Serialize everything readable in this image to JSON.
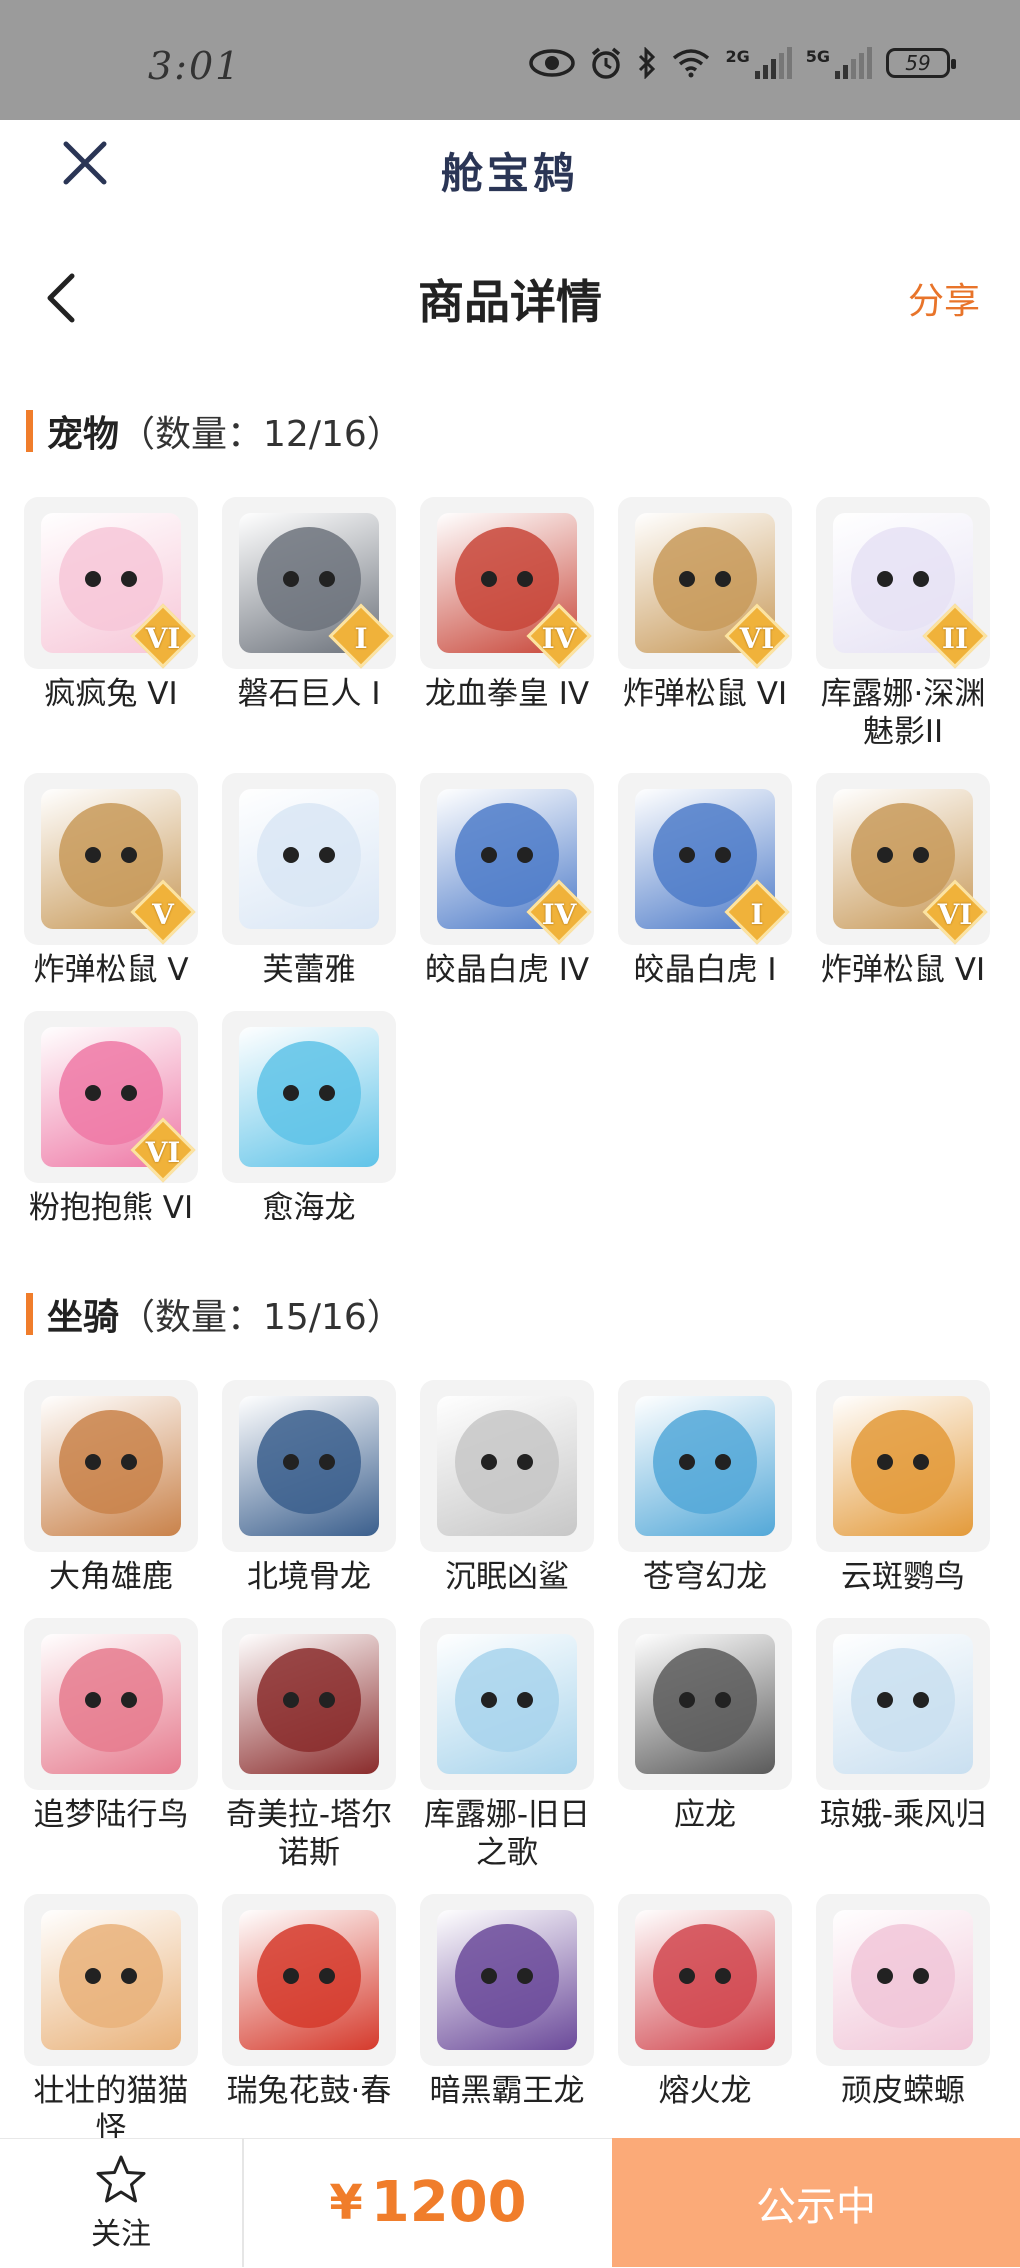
{
  "status_bar": {
    "time": "3:01",
    "battery": "59",
    "net1": "2G",
    "net2": "5G"
  },
  "header": {
    "app_title": "舱宝鸫"
  },
  "nav": {
    "title": "商品详情",
    "share": "分享"
  },
  "pets": {
    "section_name": "宠物",
    "count_text": "（数量：12/16）",
    "items": [
      {
        "label": "疯疯兔 VI",
        "tier": "VI",
        "color": "#f7c7d8"
      },
      {
        "label": "磐石巨人 I",
        "tier": "I",
        "color": "#6d737c"
      },
      {
        "label": "龙血拳皇 IV",
        "tier": "IV",
        "color": "#c8473a"
      },
      {
        "label": "炸弹松鼠 VI",
        "tier": "VI",
        "color": "#c89a5a"
      },
      {
        "label": "库露娜·深渊魅影II",
        "tier": "II",
        "color": "#e6e2f4"
      },
      {
        "label": "炸弹松鼠 V",
        "tier": "V",
        "color": "#c89a5a"
      },
      {
        "label": "芙蕾雅",
        "tier": "",
        "color": "#d9e6f5"
      },
      {
        "label": "皎晶白虎 IV",
        "tier": "IV",
        "color": "#4f7cc9"
      },
      {
        "label": "皎晶白虎 I",
        "tier": "I",
        "color": "#4f7cc9"
      },
      {
        "label": "炸弹松鼠 VI",
        "tier": "VI",
        "color": "#c89a5a"
      },
      {
        "label": "粉抱抱熊 VI",
        "tier": "VI",
        "color": "#ee79a6"
      },
      {
        "label": "愈海龙",
        "tier": "",
        "color": "#5fc3e8"
      }
    ]
  },
  "mounts": {
    "section_name": "坐骑",
    "count_text": "（数量：15/16）",
    "items": [
      {
        "label": "大角雄鹿",
        "color": "#c9824a"
      },
      {
        "label": "北境骨龙",
        "color": "#3b5f8d"
      },
      {
        "label": "沉眠凶鲨",
        "color": "#c7c7c7"
      },
      {
        "label": "苍穹幻龙",
        "color": "#53a8d8"
      },
      {
        "label": "云斑鹦鸟",
        "color": "#e39a3a"
      },
      {
        "label": "追梦陆行鸟",
        "color": "#e67b8e"
      },
      {
        "label": "奇美拉-塔尔诺斯",
        "color": "#8a2b2b"
      },
      {
        "label": "库露娜-旧日之歌",
        "color": "#a8d4ec"
      },
      {
        "label": "应龙",
        "color": "#5a5a5a"
      },
      {
        "label": "琼娥-乘风归",
        "color": "#c9dff0"
      },
      {
        "label": "壮壮的猫猫怪",
        "color": "#e9b27a"
      },
      {
        "label": "瑞兔花鼓·春",
        "color": "#d53a2c"
      },
      {
        "label": "暗黑霸王龙",
        "color": "#6b4a9a"
      },
      {
        "label": "熔火龙",
        "color": "#d1474f"
      },
      {
        "label": "顽皮蝾螈",
        "color": "#f1c6d8"
      }
    ]
  },
  "bottom": {
    "follow": "关注",
    "currency": "¥",
    "price": "1200",
    "status": "公示中"
  }
}
